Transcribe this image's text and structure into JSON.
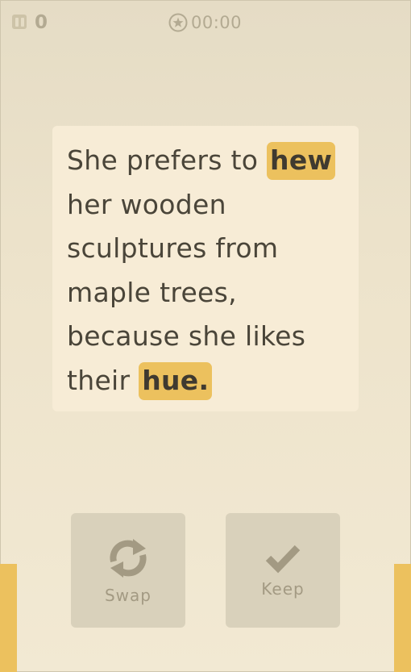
{
  "header": {
    "score": "0",
    "timer": "00:00",
    "pause_icon": "pause-icon",
    "timer_icon": "star-timer-icon"
  },
  "sentence": {
    "part1": "She prefers to ",
    "word1": "hew",
    "part2": " her wooden sculptures from maple trees, because she likes their ",
    "word2": "hue."
  },
  "buttons": {
    "swap_label": "Swap",
    "swap_icon": "swap-arrows-icon",
    "keep_label": "Keep",
    "keep_icon": "checkmark-icon"
  },
  "colors": {
    "highlight": "#ecc15e",
    "card": "#f7ecd6",
    "button": "#d9d1bb",
    "muted_text": "#b3aa92"
  }
}
